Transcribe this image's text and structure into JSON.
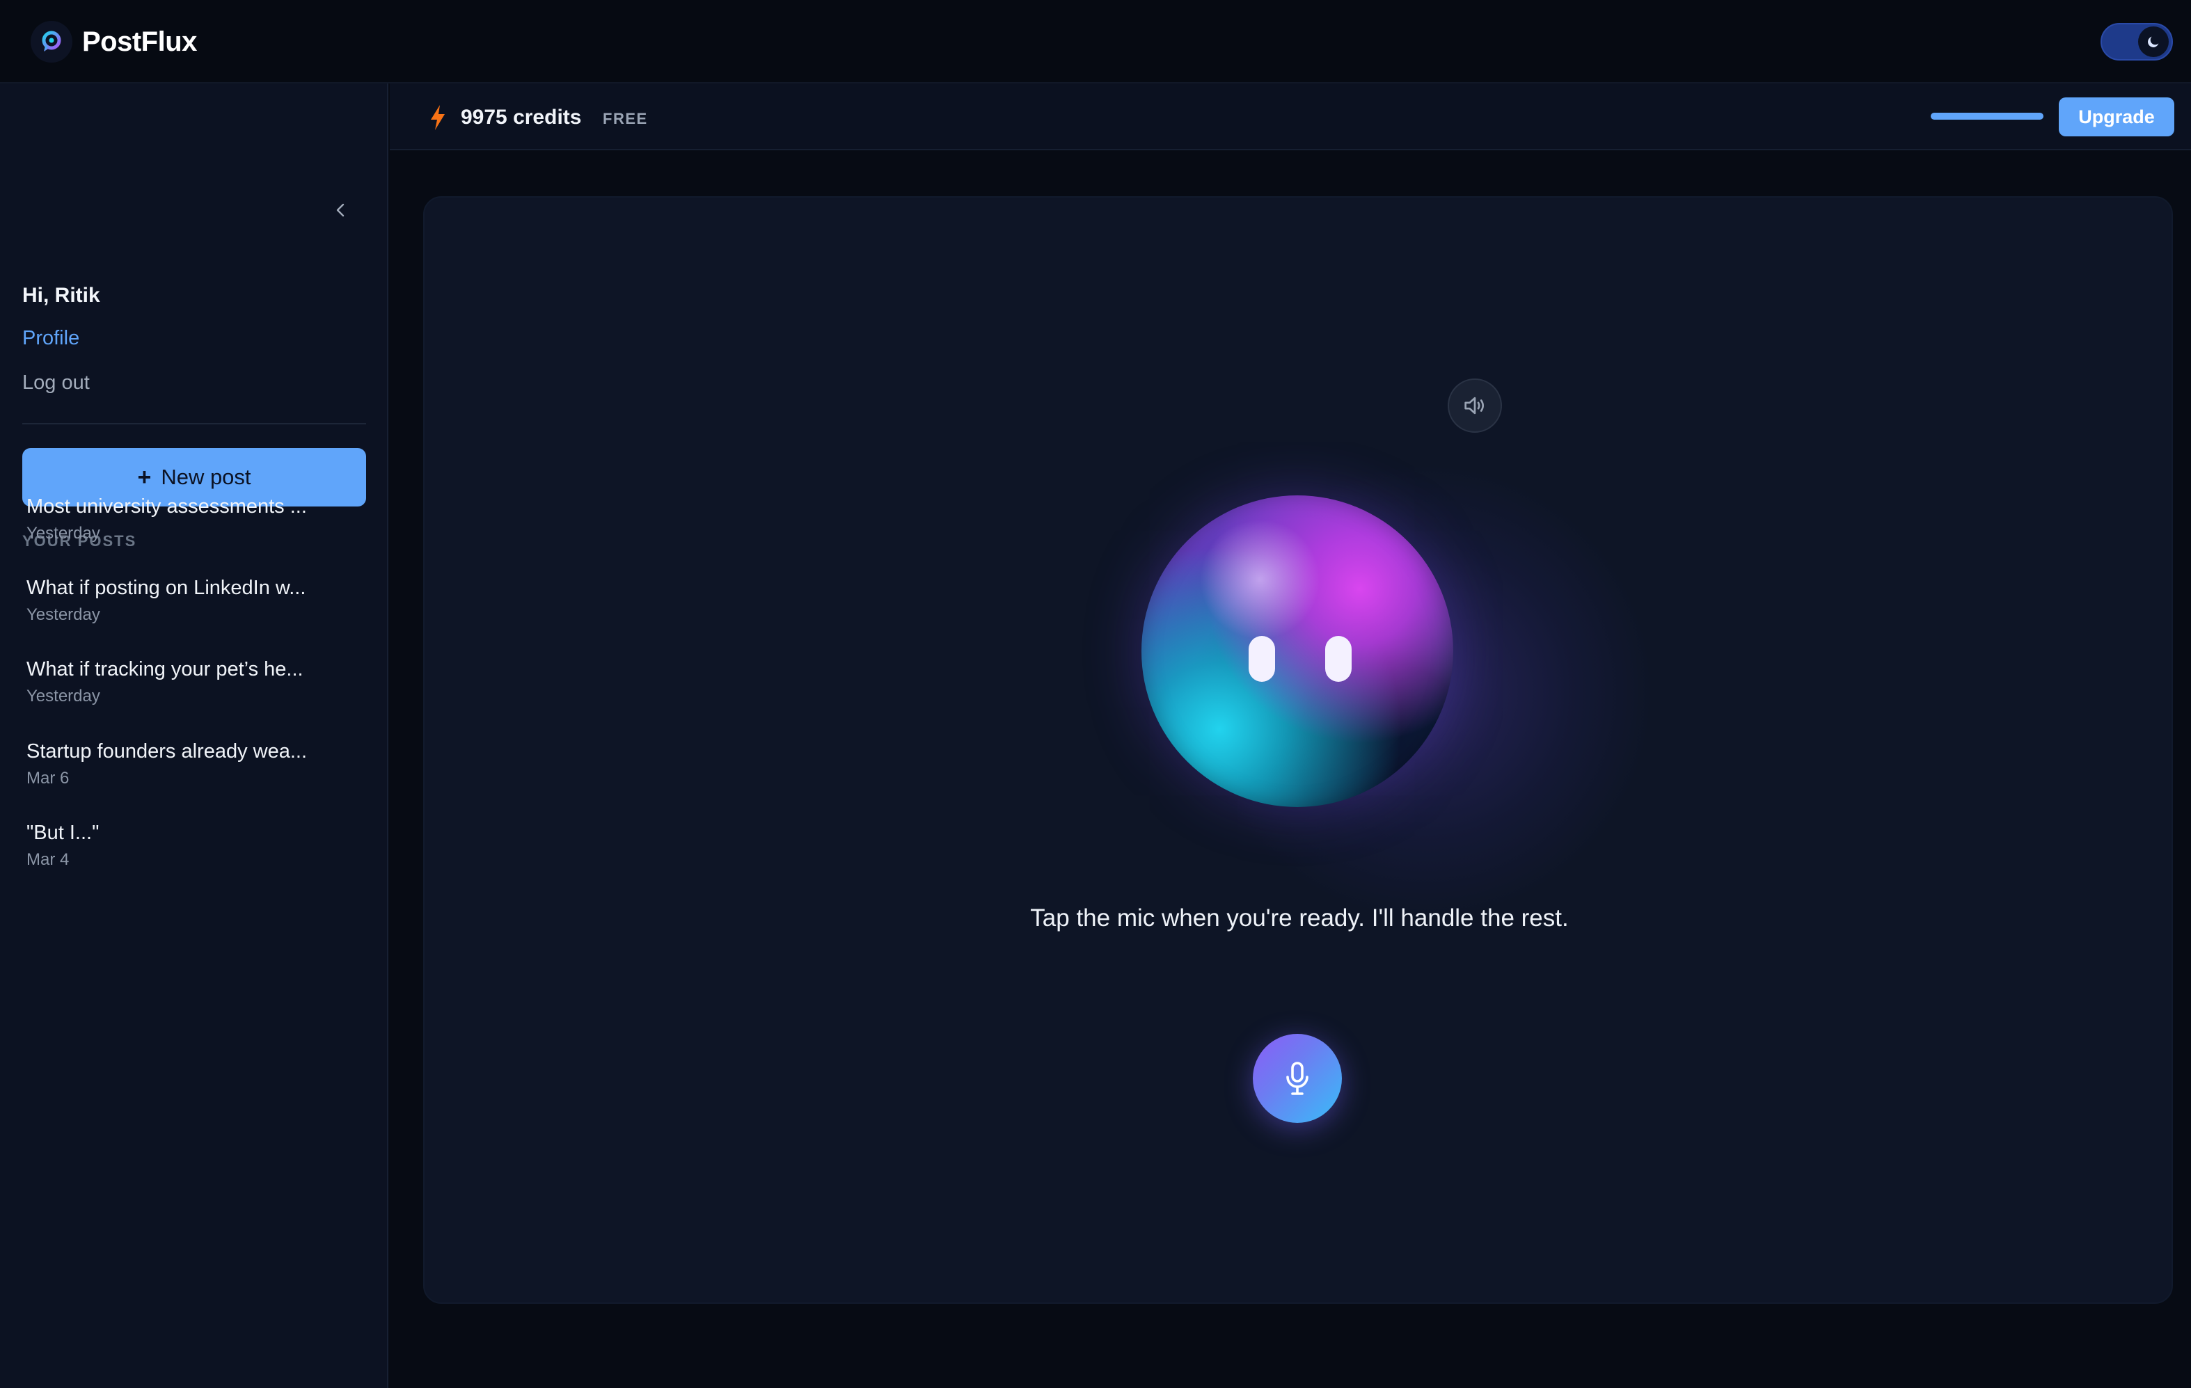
{
  "app": {
    "name": "PostFlux"
  },
  "header": {
    "theme_toggle": {
      "mode": "dark",
      "icon": "moon-icon"
    }
  },
  "sidebar": {
    "greeting": "Hi, Ritik",
    "profile_label": "Profile",
    "logout_label": "Log out",
    "new_post_label": "New post",
    "new_post_icon": "plus-icon",
    "section_label": "YOUR POSTS",
    "posts": [
      {
        "title": "Most university assessments ...",
        "date": "Yesterday"
      },
      {
        "title": "What if posting on LinkedIn w...",
        "date": "Yesterday"
      },
      {
        "title": "What if tracking your pet’s he...",
        "date": "Yesterday"
      },
      {
        "title": "Startup founders already wea...",
        "date": "Mar 6"
      },
      {
        "title": "\"But I...\"",
        "date": "Mar 4"
      }
    ]
  },
  "credits": {
    "icon": "lightning-bolt-icon",
    "text": "9975 credits",
    "plan": "FREE",
    "usage_fraction": 1.0,
    "upgrade_label": "Upgrade"
  },
  "main": {
    "sound_icon": "speaker-icon",
    "prompt": "Tap the mic when you're ready. I'll handle the rest.",
    "mic_icon": "microphone-icon"
  },
  "colors": {
    "accent": "#60a5fa",
    "background": "#070b14",
    "sidebar": "#0c1222",
    "panel": "#0e1526",
    "bolt": "#f97316",
    "orb_magenta": "#d946ef",
    "orb_cyan": "#22d3ee",
    "mic_start": "#8b5cf6",
    "mic_end": "#38bdf8"
  }
}
